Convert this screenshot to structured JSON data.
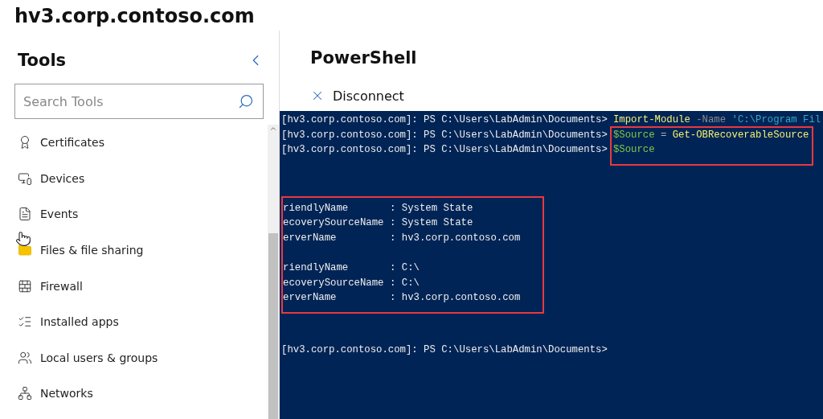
{
  "page_title": "hv3.corp.contoso.com",
  "tools": {
    "heading": "Tools",
    "search": {
      "placeholder": "Search Tools"
    },
    "items": [
      {
        "label": "Certificates"
      },
      {
        "label": "Devices"
      },
      {
        "label": "Events"
      },
      {
        "label": "Files & file sharing"
      },
      {
        "label": "Firewall"
      },
      {
        "label": "Installed apps"
      },
      {
        "label": "Local users & groups"
      },
      {
        "label": "Networks"
      }
    ]
  },
  "powershell": {
    "heading": "PowerShell",
    "disconnect": "Disconnect",
    "blocks": [
      {
        "kind": "commands",
        "boxed": false,
        "lines": [
          {
            "prompt": "[hv3.corp.contoso.com]: PS C:\\Users\\LabAdmin\\Documents>",
            "segments": [
              {
                "kind": "command",
                "text": "Import-Module"
              },
              {
                "kind": "parameter",
                "text": "-Name"
              },
              {
                "kind": "string",
                "text": "'C:\\Program Fil"
              }
            ]
          }
        ]
      },
      {
        "kind": "commands",
        "boxed": true,
        "lines": [
          {
            "prompt": "[hv3.corp.contoso.com]: PS C:\\Users\\LabAdmin\\Documents>",
            "segments": [
              {
                "kind": "variable",
                "text": "$Source"
              },
              {
                "kind": "operator",
                "text": "="
              },
              {
                "kind": "command",
                "text": "Get-OBRecoverableSource"
              }
            ]
          },
          {
            "prompt": "[hv3.corp.contoso.com]: PS C:\\Users\\LabAdmin\\Documents>",
            "segments": [
              {
                "kind": "variable",
                "text": "$Source"
              }
            ]
          }
        ]
      },
      {
        "kind": "output",
        "boxed": true,
        "separator": ":",
        "records": [
          [
            {
              "name": "riendlyName",
              "value": "System State"
            },
            {
              "name": "ecoverySourceName",
              "value": "System State"
            },
            {
              "name": "erverName",
              "value": "hv3.corp.contoso.com"
            }
          ],
          [
            {
              "name": "riendlyName",
              "value": "C:\\"
            },
            {
              "name": "ecoverySourceName",
              "value": "C:\\"
            },
            {
              "name": "erverName",
              "value": "hv3.corp.contoso.com"
            }
          ]
        ]
      },
      {
        "kind": "commands",
        "boxed": false,
        "lines": [
          {
            "prompt": "[hv3.corp.contoso.com]: PS C:\\Users\\LabAdmin\\Documents>"
          }
        ]
      }
    ]
  }
}
